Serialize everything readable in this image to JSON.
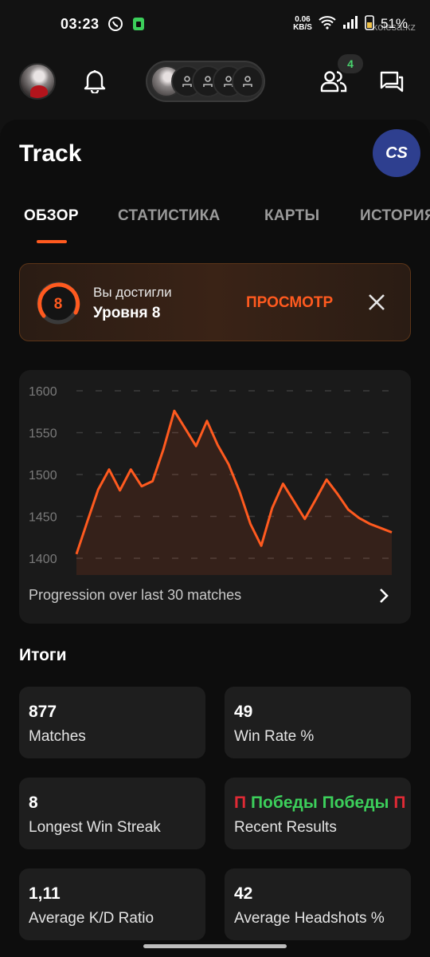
{
  "status_bar": {
    "time": "03:23",
    "net_speed_value": "0.06",
    "net_speed_unit": "KB/S",
    "battery": "51%",
    "watermark": "kolesa.kz"
  },
  "header": {
    "friends_badge": "4"
  },
  "page": {
    "title": "Track",
    "game_logo_text": "CS"
  },
  "tabs": [
    {
      "label": "ОБЗОР",
      "active": true
    },
    {
      "label": "СТАТИСТИКА",
      "active": false
    },
    {
      "label": "КАРТЫ",
      "active": false
    },
    {
      "label": "ИСТОРИЯ",
      "active": false
    }
  ],
  "level_banner": {
    "level": "8",
    "line1": "Вы достигли",
    "line2": "Уровня 8",
    "action": "ПРОСМОТР",
    "accent": "#ff5a1f"
  },
  "chart_data": {
    "type": "area",
    "caption": "Progression over last 30 matches",
    "y_ticks": [
      "1600",
      "1550",
      "1500",
      "1450",
      "1400"
    ],
    "ylim": [
      1390,
      1610
    ],
    "grid": "dashed-horizontal",
    "color": "#ff5a1f",
    "x": [
      1,
      2,
      3,
      4,
      5,
      6,
      7,
      8,
      9,
      10,
      11,
      12,
      13,
      14,
      15,
      16,
      17,
      18,
      19,
      20,
      21,
      22,
      23,
      24,
      25,
      26,
      27,
      28,
      29,
      30
    ],
    "values": [
      1405,
      1444,
      1482,
      1506,
      1481,
      1506,
      1486,
      1492,
      1530,
      1576,
      1555,
      1534,
      1564,
      1535,
      1512,
      1480,
      1441,
      1415,
      1460,
      1489,
      1468,
      1447,
      1470,
      1494,
      1477,
      1458,
      1448,
      1441,
      1436,
      1431
    ]
  },
  "summary": {
    "title": "Итоги",
    "cards": [
      {
        "value": "877",
        "label": "Matches"
      },
      {
        "value": "49",
        "label": "Win Rate %"
      },
      {
        "value": "8",
        "label": "Longest Win Streak"
      },
      {
        "value_parts": [
          "П",
          "Победы",
          "Победы",
          "П"
        ],
        "label": "Recent Results"
      },
      {
        "value": "1,11",
        "label": "Average K/D Ratio"
      },
      {
        "value": "42",
        "label": "Average Headshots %"
      }
    ]
  },
  "icons": [
    "whatsapp-icon",
    "sim-icon",
    "wifi-icon",
    "signal-icon",
    "battery-icon",
    "bell-icon",
    "friends-icon",
    "chat-icon",
    "close-icon",
    "chevron-right-icon"
  ]
}
